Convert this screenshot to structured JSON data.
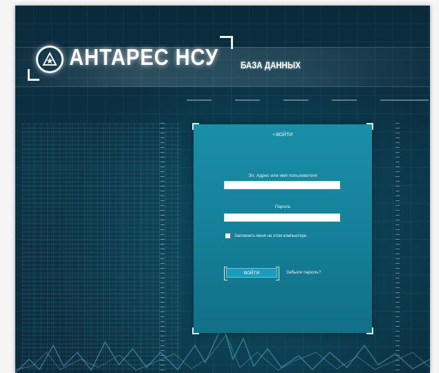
{
  "header": {
    "brand": "АНТАРЕС НСУ",
    "subtitle": "БАЗА ДАННЫХ"
  },
  "login": {
    "title": "• ВОЙТИ",
    "username_label": "Эл. Адрес или имя пользователя",
    "username_value": "",
    "password_label": "Пароль",
    "password_value": "",
    "remember_label": "Запомнить меня на этом компьютере",
    "submit_label": "ВОЙТИ",
    "forgot_label": "Забыли пароль?"
  },
  "colors": {
    "background": "#0b2c3c",
    "panel": "#167f98",
    "accent": "#1d9bbb",
    "text": "#e6f4f8"
  }
}
